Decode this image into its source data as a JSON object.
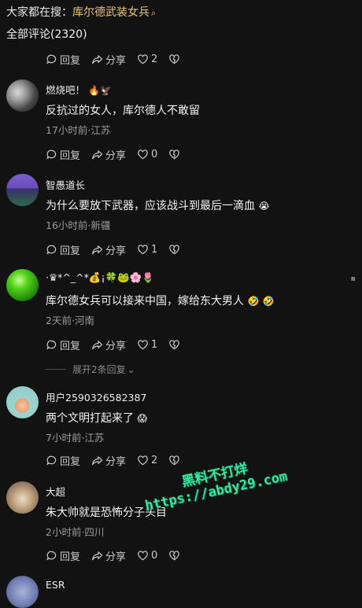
{
  "header": {
    "prefix": "大家都在搜：",
    "keyword": "库尔德武装女兵",
    "total_label": "全部评论(2320)"
  },
  "actions": {
    "reply": "回复",
    "share": "分享"
  },
  "top_actions": {
    "likes": "2"
  },
  "comments": [
    {
      "user": "燃烧吧！",
      "text": "反抗过的女人，库尔德人不敢留",
      "meta": "17小时前·江苏",
      "likes": "0"
    },
    {
      "user": "智愚道长",
      "text": "为什么要放下武器，应该战斗到最后一滴血",
      "meta": "16小时前·新疆",
      "likes": "1"
    },
    {
      "user": "·♛*^_^*💰¡🍀🐸🌸🌷",
      "text": "库尔德女兵可以接来中国，嫁给东大男人",
      "meta": "2天前·河南",
      "likes": "1"
    },
    {
      "user": "用户2590326582387",
      "text": "两个文明打起来了",
      "meta": "7小时前·江苏",
      "likes": "2"
    },
    {
      "user": "大超",
      "text": "朱大帅就是恐怖分子头目",
      "meta": "2小时前·四川",
      "likes": "0"
    },
    {
      "user": "ESR"
    }
  ],
  "expand_label": "展开2条回复",
  "watermark": {
    "line1": "黑料不打烊",
    "line2": "https://abdy29.com"
  },
  "colors": {
    "background": "#121212",
    "keyword": "#f0c37a",
    "watermark": "#39e3a0"
  }
}
